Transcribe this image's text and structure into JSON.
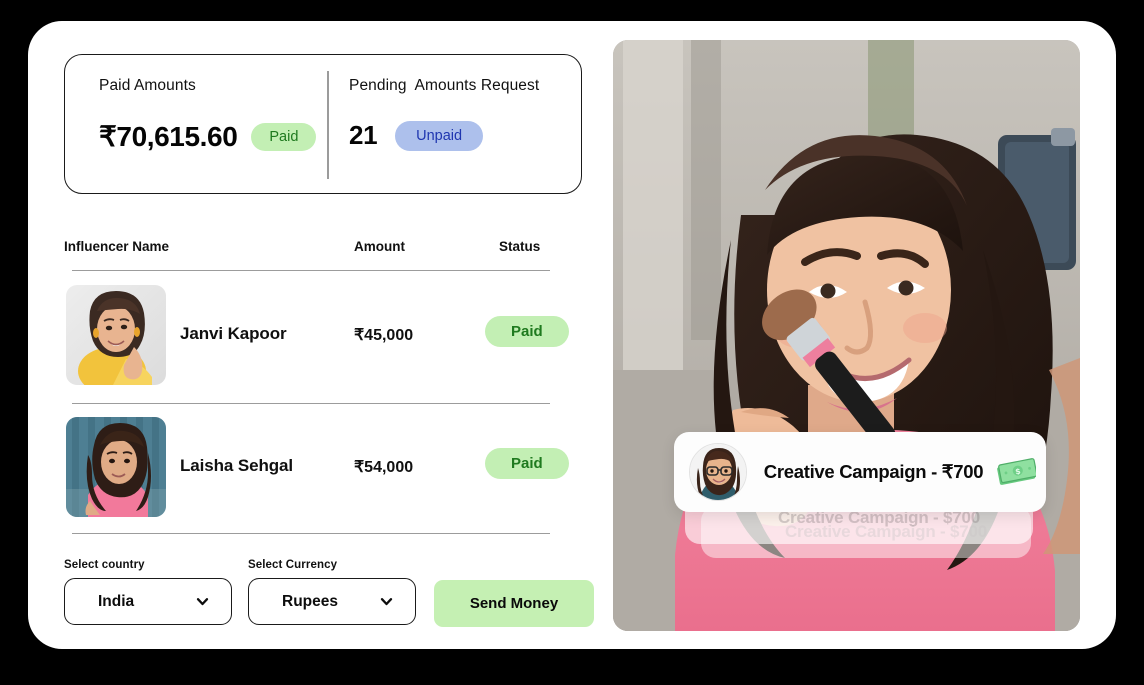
{
  "summary": {
    "paid": {
      "label": "Paid Amounts",
      "value": "₹70,615.60",
      "badge": "Paid"
    },
    "pending": {
      "label": "Pending  Amounts Request",
      "value": "21",
      "badge": "Unpaid"
    }
  },
  "table": {
    "columns": {
      "name": "Influencer Name",
      "amount": "Amount",
      "status": "Status"
    },
    "rows": [
      {
        "name": "Janvi Kapoor",
        "amount": "₹45,000",
        "status": "Paid",
        "avatar": "influencer-avatar-janvi"
      },
      {
        "name": "Laisha Sehgal",
        "amount": "₹54,000",
        "status": "Paid",
        "avatar": "influencer-avatar-laisha"
      }
    ]
  },
  "controls": {
    "country": {
      "label": "Select country",
      "value": "India",
      "chevron": "chevron-down-icon"
    },
    "currency": {
      "label": "Select Currency",
      "value": "Rupees",
      "chevron": "chevron-down-icon"
    },
    "send_button": "Send Money"
  },
  "photo": {
    "alt": "influencer-applying-blush-photo",
    "notification": {
      "avatar": "notification-avatar",
      "text": "Creative Campaign - ₹700",
      "icon": "money-banknote-icon",
      "ghost_cards": [
        "Creative Campaign - $700",
        "Creative Campaign - $700"
      ]
    }
  },
  "colors": {
    "page_background": "#000000",
    "card_background": "#ffffff",
    "paid_badge_bg": "#c3efb4",
    "paid_badge_text": "#1f7a1f",
    "unpaid_badge_bg": "#adc0ec",
    "unpaid_badge_text": "#1f36b0",
    "send_button_bg": "#c5f0b3",
    "border": "#1a1a1a",
    "divider": "#9c9c9c"
  }
}
